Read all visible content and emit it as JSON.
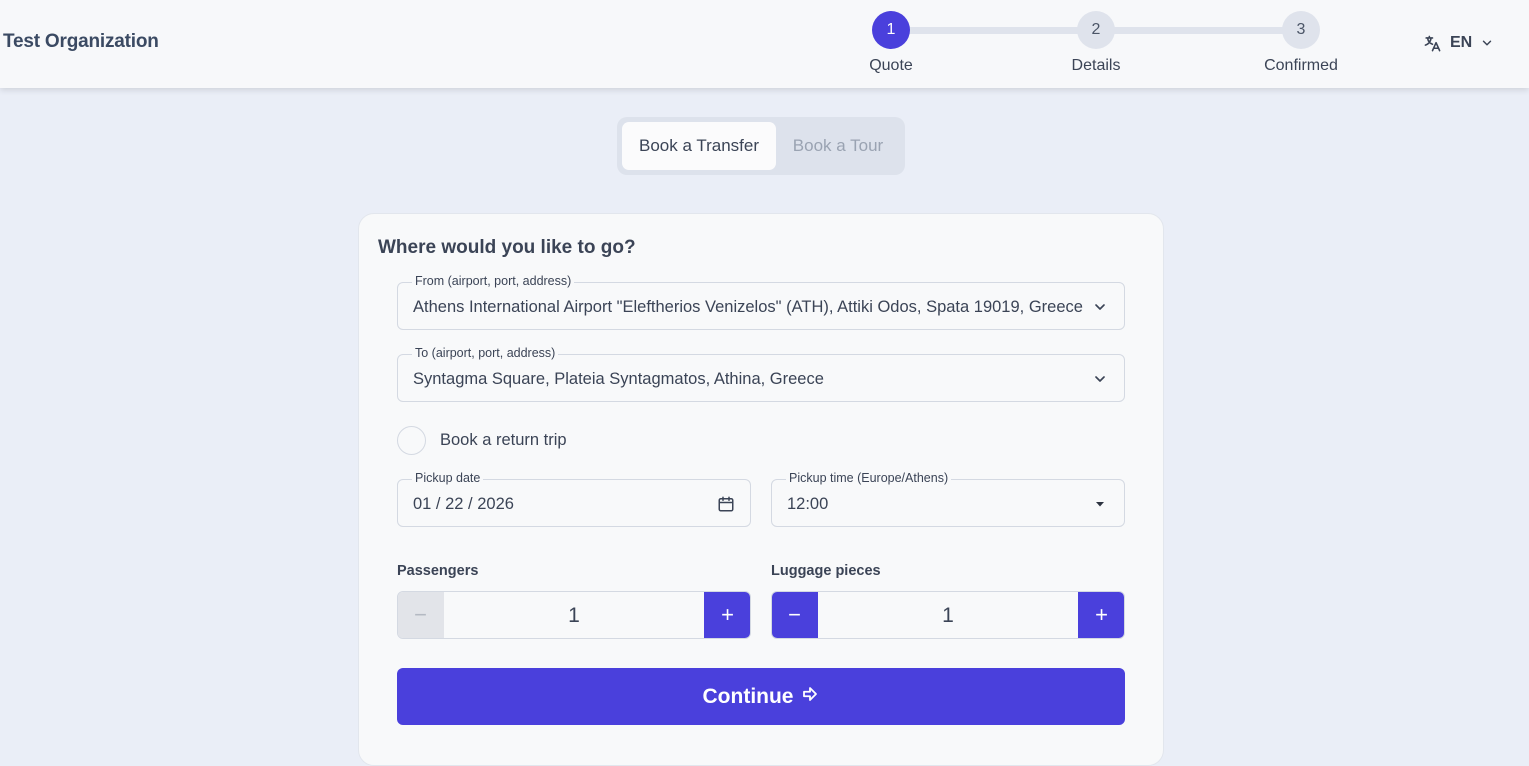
{
  "header": {
    "org_name": "Test Organization",
    "steps": [
      {
        "number": "1",
        "label": "Quote",
        "active": true
      },
      {
        "number": "2",
        "label": "Details",
        "active": false
      },
      {
        "number": "3",
        "label": "Confirmed",
        "active": false
      }
    ],
    "language": {
      "label": "EN",
      "icon": "translate-icon"
    }
  },
  "mode_toggle": {
    "options": [
      "Book a Transfer",
      "Book a Tour"
    ],
    "selected": "Book a Transfer"
  },
  "form": {
    "title": "Where would you like to go?",
    "from": {
      "label": "From (airport, port, address)",
      "value": "Athens International Airport \"Eleftherios Venizelos\" (ATH), Attiki Odos, Spata 19019, Greece"
    },
    "to": {
      "label": "To (airport, port, address)",
      "value": "Syntagma Square, Plateia Syntagmatos, Athina, Greece"
    },
    "return_trip": {
      "label": "Book a return trip",
      "checked": false
    },
    "pickup_date": {
      "label": "Pickup date",
      "value": "01 / 22 / 2026"
    },
    "pickup_time": {
      "label": "Pickup time (Europe/Athens)",
      "value": "12:00"
    },
    "passengers": {
      "label": "Passengers",
      "value": "1",
      "minus": "−",
      "plus": "+"
    },
    "luggage": {
      "label": "Luggage pieces",
      "value": "1",
      "minus": "−",
      "plus": "+"
    },
    "continue_label": "Continue"
  },
  "colors": {
    "accent": "#4a40dc",
    "page_background": "#eaeef7",
    "card_background": "#f8f9fa",
    "text": "#3b4456"
  }
}
